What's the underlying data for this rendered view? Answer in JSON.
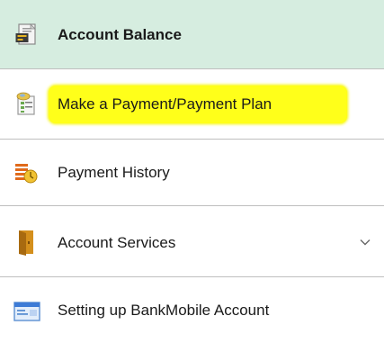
{
  "menu": {
    "items": [
      {
        "label": "Account Balance",
        "icon": "account-balance-icon",
        "selected": true
      },
      {
        "label": "Make a Payment/Payment Plan",
        "icon": "payment-plan-icon",
        "highlighted": true
      },
      {
        "label": "Payment History",
        "icon": "payment-history-icon"
      },
      {
        "label": "Account Services",
        "icon": "account-services-icon",
        "expandable": true,
        "expand_icon": "chevron-down-icon"
      },
      {
        "label": "Setting up BankMobile Account",
        "icon": "bankmobile-card-icon"
      }
    ]
  },
  "colors": {
    "selected_background": "#d6ede0",
    "highlight": "#ffff1a",
    "divider": "#bfbfbf"
  }
}
